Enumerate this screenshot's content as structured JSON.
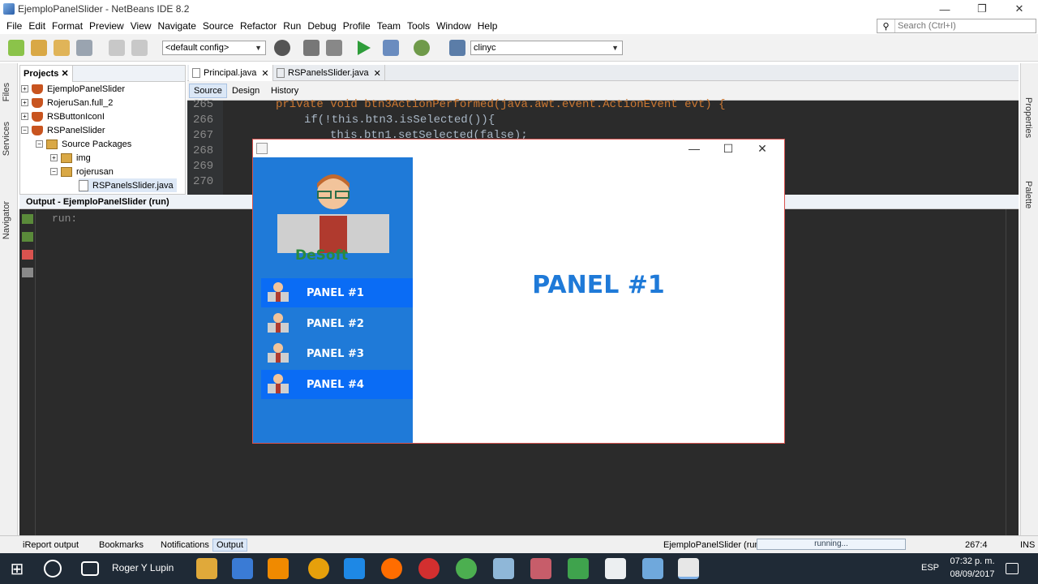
{
  "window": {
    "title": "EjemploPanelSlider - NetBeans IDE 8.2",
    "minimize": "—",
    "maximize": "❐",
    "close": "✕"
  },
  "menu": [
    "File",
    "Edit",
    "Format",
    "Preview",
    "View",
    "Navigate",
    "Source",
    "Refactor",
    "Run",
    "Debug",
    "Profile",
    "Team",
    "Tools",
    "Window",
    "Help"
  ],
  "search": {
    "placeholder": "Search (Ctrl+I)"
  },
  "toolbar": {
    "config": "<default config>",
    "run_target": "clinyc"
  },
  "left_strip": {
    "files": "Files",
    "services": "Services",
    "navigator": "Navigator"
  },
  "right_strip": {
    "properties": "Properties",
    "palette": "Palette"
  },
  "projects": {
    "tab": "Projects",
    "items": [
      {
        "label": "EjemploPanelSlider",
        "type": "project",
        "toggle": "+"
      },
      {
        "label": "RojeruSan.full_2",
        "type": "project",
        "toggle": "+"
      },
      {
        "label": "RSButtonIconI",
        "type": "project",
        "toggle": "+"
      },
      {
        "label": "RSPanelSlider",
        "type": "project",
        "toggle": "−"
      },
      {
        "label": "Source Packages",
        "type": "package",
        "toggle": "−"
      },
      {
        "label": "img",
        "type": "package",
        "toggle": "+"
      },
      {
        "label": "rojerusan",
        "type": "package",
        "toggle": "−"
      },
      {
        "label": "RSPanelsSlider.java",
        "type": "file",
        "toggle": ""
      }
    ]
  },
  "editor": {
    "tabs": [
      "Principal.java",
      "RSPanelsSlider.java"
    ],
    "subtabs": [
      "Source",
      "Design",
      "History"
    ],
    "line_numbers": [
      "265",
      "266",
      "267",
      "268",
      "269",
      "270"
    ],
    "code": {
      "l265": "private void btn3ActionPerformed(java.awt.event.ActionEvent evt) {",
      "l266": "if(!this.btn3.isSelected()){",
      "l267": "this.btn1.setSelected(false);"
    }
  },
  "output": {
    "title": "Output - EjemploPanelSlider (run)",
    "text": "run:"
  },
  "statusbar": {
    "tabs": [
      "iReport output",
      "Bookmarks",
      "Notifications",
      "Output"
    ],
    "project": "EjemploPanelSlider (run)",
    "progress": "running...",
    "position": "267:4",
    "mode": "INS"
  },
  "taskbar": {
    "user": "Roger Y Lupin",
    "lang": "ESP",
    "time": "07:32 p. m.",
    "date": "08/09/2017"
  },
  "app": {
    "logo_text": "DeSoft",
    "buttons": [
      "PANEL #1",
      "PANEL #2",
      "PANEL #3",
      "PANEL #4"
    ],
    "selected": "PANEL #1",
    "content_title": "PANEL #1",
    "colors": {
      "sidebar": "#1f7ad8",
      "button_active": "#0a6cf5",
      "accent": "#1f7ad8"
    }
  }
}
